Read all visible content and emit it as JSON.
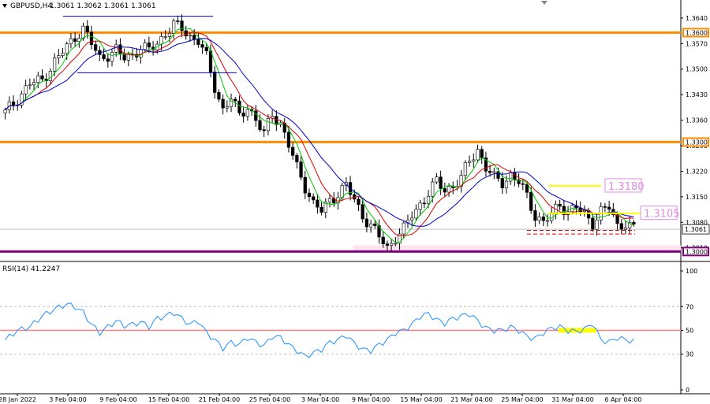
{
  "header": {
    "symbol_label": "GBPUSD,H4",
    "ohlc_label": "1.3061 1.3062 1.3061 1.3061"
  },
  "rsi_panel": {
    "label": "RSI(14) 41.2247"
  },
  "colors": {
    "background": "#ffffff",
    "candle": "#000000",
    "ma_fast": "#00c800",
    "ma_mid": "#dc0000",
    "ma_slow": "#0000c8",
    "resistance": "#ff8c00",
    "support": "#800080",
    "range": "#ffff00",
    "annotation": "#e08be0",
    "rsi_line": "#1e90ff",
    "rsi_level": "#ff8080",
    "axis": "#000000",
    "grid": "#c0c0c0",
    "marker_box": "#ffffff"
  },
  "chart_data": [
    {
      "type": "candlestick",
      "title": "GBPUSD,H4",
      "ylim": [
        1.2977,
        1.367
      ],
      "y_ticks": [
        1.364,
        1.357,
        1.35,
        1.343,
        1.336,
        1.329,
        1.322,
        1.315,
        1.308,
        1.301
      ],
      "x_tick_labels": [
        "28 Jan 2022",
        "3 Feb 04:00",
        "9 Feb 04:00",
        "15 Feb 04:00",
        "21 Feb 04:00",
        "25 Feb 04:00",
        "3 Mar 04:00",
        "9 Mar 04:00",
        "15 Mar 04:00",
        "21 Mar 04:00",
        "25 Mar 04:00",
        "31 Mar 04:00",
        "6 Apr 04:00"
      ],
      "horizontal_levels": [
        {
          "label": "1.3600",
          "value": 1.36,
          "color_key": "resistance"
        },
        {
          "label": "1.3300",
          "value": 1.33,
          "color_key": "resistance"
        },
        {
          "label": "1.3000",
          "value": 1.3,
          "color_key": "support"
        }
      ],
      "annotations": [
        {
          "label": "1.3180",
          "value": 1.318
        },
        {
          "label": "1.3105",
          "value": 1.3105
        }
      ],
      "current_price_label": "1.3061",
      "current_price": 1.3061,
      "price_path": [
        [
          0,
          1.338
        ],
        [
          3,
          1.342
        ],
        [
          6,
          1.346
        ],
        [
          9,
          1.347
        ],
        [
          12,
          1.352
        ],
        [
          15,
          1.356
        ],
        [
          17,
          1.359
        ],
        [
          19,
          1.361
        ],
        [
          21,
          1.357
        ],
        [
          23,
          1.353
        ],
        [
          25,
          1.354
        ],
        [
          27,
          1.355
        ],
        [
          29,
          1.353
        ],
        [
          31,
          1.354
        ],
        [
          33,
          1.356
        ],
        [
          35,
          1.355
        ],
        [
          37,
          1.357
        ],
        [
          39,
          1.36
        ],
        [
          41,
          1.362
        ],
        [
          43,
          1.361
        ],
        [
          45,
          1.359
        ],
        [
          47,
          1.358
        ],
        [
          49,
          1.353
        ],
        [
          51,
          1.345
        ],
        [
          53,
          1.339
        ],
        [
          55,
          1.342
        ],
        [
          57,
          1.337
        ],
        [
          59,
          1.34
        ],
        [
          61,
          1.336
        ],
        [
          63,
          1.332
        ],
        [
          65,
          1.338
        ],
        [
          67,
          1.335
        ],
        [
          69,
          1.329
        ],
        [
          71,
          1.323
        ],
        [
          73,
          1.318
        ],
        [
          75,
          1.313
        ],
        [
          77,
          1.311
        ],
        [
          79,
          1.314
        ],
        [
          81,
          1.316
        ],
        [
          83,
          1.318
        ],
        [
          85,
          1.314
        ],
        [
          87,
          1.31
        ],
        [
          89,
          1.307
        ],
        [
          91,
          1.304
        ],
        [
          93,
          1.301
        ],
        [
          95,
          1.304
        ],
        [
          97,
          1.306
        ],
        [
          99,
          1.31
        ],
        [
          101,
          1.313
        ],
        [
          103,
          1.316
        ],
        [
          105,
          1.319
        ],
        [
          107,
          1.317
        ],
        [
          109,
          1.318
        ],
        [
          111,
          1.32
        ],
        [
          113,
          1.325
        ],
        [
          115,
          1.328
        ],
        [
          117,
          1.323
        ],
        [
          119,
          1.32
        ],
        [
          121,
          1.319
        ],
        [
          123,
          1.321
        ],
        [
          125,
          1.319
        ],
        [
          127,
          1.315
        ],
        [
          129,
          1.31
        ],
        [
          131,
          1.308
        ],
        [
          133,
          1.31
        ],
        [
          135,
          1.313
        ],
        [
          137,
          1.311
        ],
        [
          139,
          1.312
        ],
        [
          141,
          1.31
        ],
        [
          143,
          1.308
        ],
        [
          145,
          1.311
        ],
        [
          147,
          1.312
        ],
        [
          149,
          1.307
        ],
        [
          151,
          1.308
        ],
        [
          153,
          1.3061
        ]
      ]
    },
    {
      "type": "line",
      "title": "RSI(14) 41.2247",
      "ylim": [
        0,
        100
      ],
      "y_ticks": [
        100,
        70,
        50,
        30,
        0
      ],
      "levels": [
        50
      ],
      "series": [
        {
          "values": [
            [
              0,
              42
            ],
            [
              3,
              50
            ],
            [
              6,
              53
            ],
            [
              9,
              62
            ],
            [
              12,
              68
            ],
            [
              15,
              72
            ],
            [
              17,
              70
            ],
            [
              19,
              65
            ],
            [
              21,
              55
            ],
            [
              23,
              48
            ],
            [
              25,
              53
            ],
            [
              27,
              58
            ],
            [
              29,
              54
            ],
            [
              31,
              55
            ],
            [
              33,
              57
            ],
            [
              35,
              53
            ],
            [
              37,
              60
            ],
            [
              39,
              62
            ],
            [
              41,
              65
            ],
            [
              43,
              60
            ],
            [
              45,
              55
            ],
            [
              47,
              58
            ],
            [
              49,
              48
            ],
            [
              51,
              42
            ],
            [
              53,
              35
            ],
            [
              55,
              40
            ],
            [
              57,
              38
            ],
            [
              59,
              44
            ],
            [
              61,
              40
            ],
            [
              63,
              37
            ],
            [
              65,
              45
            ],
            [
              67,
              44
            ],
            [
              69,
              38
            ],
            [
              71,
              33
            ],
            [
              73,
              28
            ],
            [
              75,
              31
            ],
            [
              77,
              34
            ],
            [
              79,
              40
            ],
            [
              81,
              42
            ],
            [
              83,
              46
            ],
            [
              85,
              39
            ],
            [
              87,
              34
            ],
            [
              89,
              33
            ],
            [
              91,
              38
            ],
            [
              93,
              42
            ],
            [
              95,
              48
            ],
            [
              97,
              50
            ],
            [
              99,
              55
            ],
            [
              101,
              62
            ],
            [
              103,
              64
            ],
            [
              105,
              59
            ],
            [
              107,
              56
            ],
            [
              109,
              60
            ],
            [
              111,
              62
            ],
            [
              113,
              64
            ],
            [
              115,
              58
            ],
            [
              117,
              52
            ],
            [
              119,
              50
            ],
            [
              121,
              50
            ],
            [
              123,
              53
            ],
            [
              125,
              50
            ],
            [
              127,
              45
            ],
            [
              129,
              43
            ],
            [
              131,
              48
            ],
            [
              133,
              52
            ],
            [
              135,
              53
            ],
            [
              137,
              50
            ],
            [
              139,
              49
            ],
            [
              141,
              51
            ],
            [
              143,
              56
            ],
            [
              145,
              42
            ],
            [
              147,
              40
            ],
            [
              149,
              44
            ],
            [
              151,
              42
            ],
            [
              153,
              41
            ]
          ]
        }
      ]
    }
  ]
}
